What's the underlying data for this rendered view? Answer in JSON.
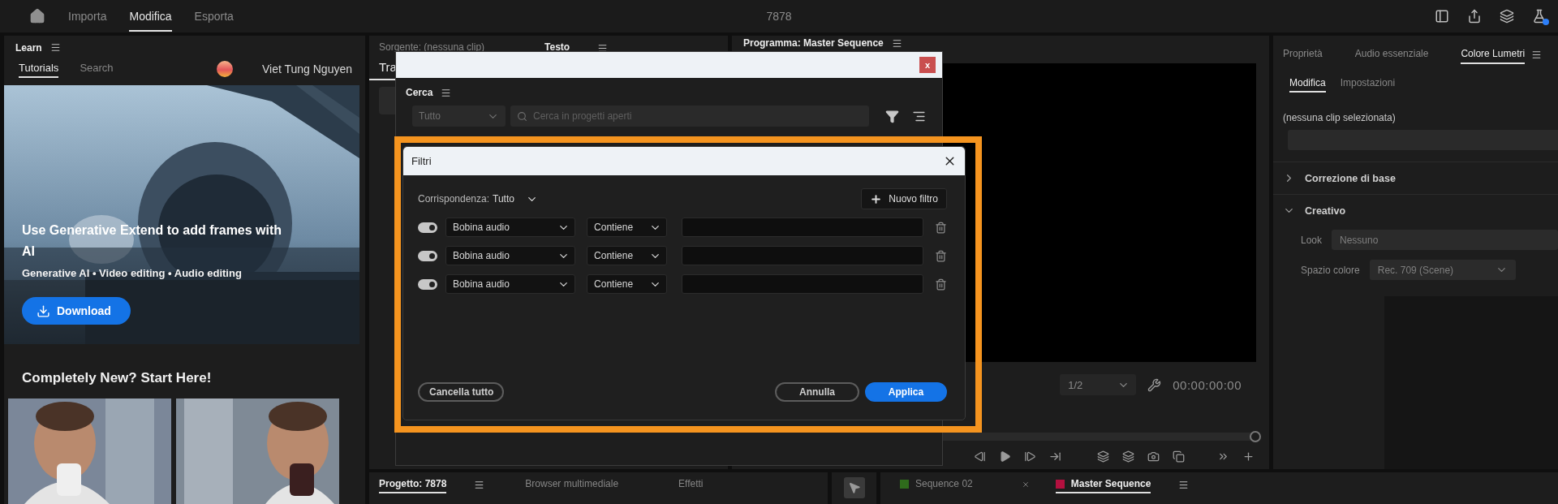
{
  "top_bar": {
    "tabs": [
      {
        "label": "Importa",
        "selected": false
      },
      {
        "label": "Modifica",
        "selected": true
      },
      {
        "label": "Esporta",
        "selected": false
      }
    ],
    "project_title": "7878"
  },
  "learn_panel": {
    "title": "Learn",
    "tabs": [
      {
        "label": "Tutorials",
        "selected": true
      },
      {
        "label": "Search",
        "selected": false
      }
    ],
    "user_name": "Viet Tung Nguyen",
    "hero": {
      "title": "Use Generative Extend to add frames with AI",
      "tags": "Generative AI • Video editing • Audio editing",
      "button": "Download"
    },
    "section_title": "Completely New? Start Here!"
  },
  "source_panel": {
    "tabs": [
      {
        "label": "Sorgente: (nessuna clip)",
        "selected": false
      },
      {
        "label": "Testo",
        "selected": true
      }
    ],
    "subtab": "Tra"
  },
  "program_panel": {
    "title": "Programma: Master Sequence",
    "zoom": "1/2",
    "timecode": "00:00:00:00"
  },
  "lumetri_panel": {
    "tabs": [
      {
        "label": "Proprietà",
        "selected": false
      },
      {
        "label": "Audio essenziale",
        "selected": false
      },
      {
        "label": "Colore Lumetri",
        "selected": true
      }
    ],
    "subtabs": [
      {
        "label": "Modifica",
        "selected": true
      },
      {
        "label": "Impostazioni",
        "selected": false
      }
    ],
    "clip_status": "(nessuna clip selezionata)",
    "sections": [
      {
        "title": "Correzione di base",
        "expanded": false
      },
      {
        "title": "Creativo",
        "expanded": true
      }
    ],
    "look": {
      "label": "Look",
      "value": "Nessuno"
    },
    "color_space": {
      "label": "Spazio colore",
      "value": "Rec. 709 (Scene)"
    }
  },
  "project_panel": {
    "tabs": [
      {
        "label": "Progetto: 7878",
        "selected": true
      },
      {
        "label": "Browser multimediale",
        "selected": false
      },
      {
        "label": "Effetti",
        "selected": false
      }
    ]
  },
  "timeline_panel": {
    "tabs": [
      {
        "label": "Sequence 02",
        "selected": false,
        "color": "#2f6b1c"
      },
      {
        "label": "Master Sequence",
        "selected": true,
        "color": "#b3103f"
      }
    ]
  },
  "search_dialog": {
    "close_label": "x",
    "title": "Cerca",
    "scope": "Tutto",
    "placeholder": "Cerca in progetti aperti"
  },
  "filter_dialog": {
    "title": "Filtri",
    "match_label": "Corrispondenza:",
    "match_value": "Tutto",
    "new_filter": "Nuovo filtro",
    "filters": [
      {
        "on": true,
        "field": "Bobina audio",
        "operator": "Contiene"
      },
      {
        "on": true,
        "field": "Bobina audio",
        "operator": "Contiene"
      },
      {
        "on": true,
        "field": "Bobina audio",
        "operator": "Contiene"
      }
    ],
    "buttons": {
      "clear": "Cancella tutto",
      "cancel": "Annulla",
      "apply": "Applica"
    }
  }
}
